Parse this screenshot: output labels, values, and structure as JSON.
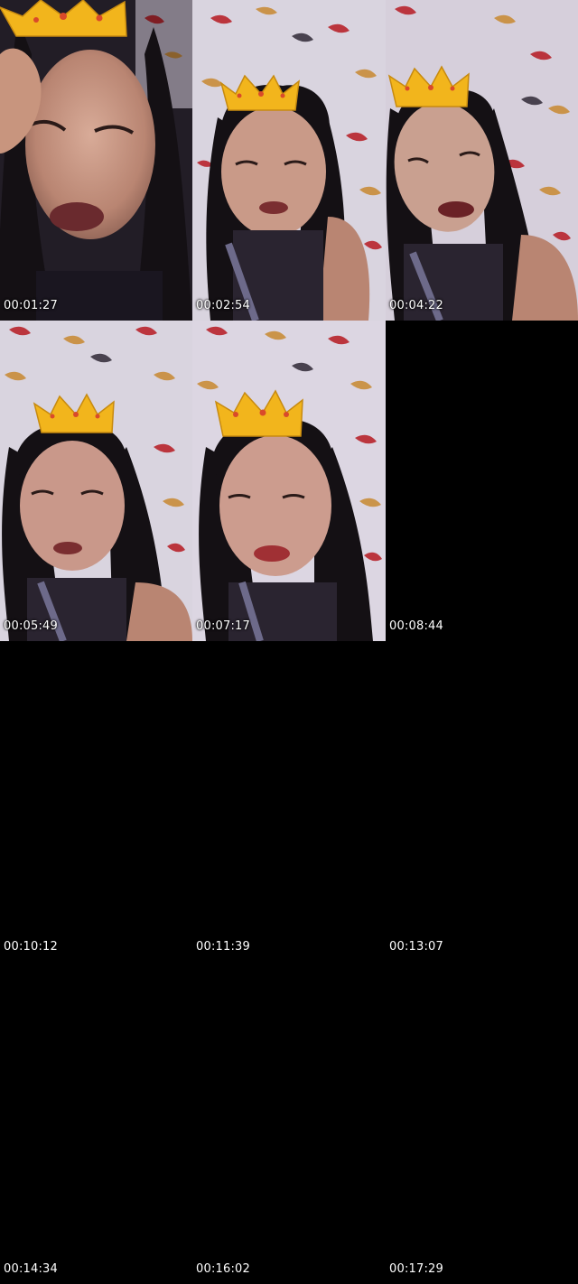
{
  "contact_sheet": {
    "frames": [
      {
        "timestamp": "00:01:27",
        "content": "photo",
        "scene": "portrait-closeup-hand-on-forehead"
      },
      {
        "timestamp": "00:02:54",
        "content": "photo",
        "scene": "portrait-wallpaper"
      },
      {
        "timestamp": "00:04:22",
        "content": "photo",
        "scene": "portrait-wallpaper-tilted"
      },
      {
        "timestamp": "00:05:49",
        "content": "photo",
        "scene": "portrait-wallpaper"
      },
      {
        "timestamp": "00:07:17",
        "content": "photo",
        "scene": "portrait-wallpaper"
      },
      {
        "timestamp": "00:08:44",
        "content": "blank"
      },
      {
        "timestamp": "00:10:12",
        "content": "blank"
      },
      {
        "timestamp": "00:11:39",
        "content": "blank"
      },
      {
        "timestamp": "00:13:07",
        "content": "blank"
      },
      {
        "timestamp": "00:14:34",
        "content": "blank"
      },
      {
        "timestamp": "00:16:02",
        "content": "blank"
      },
      {
        "timestamp": "00:17:29",
        "content": "blank"
      }
    ],
    "colors": {
      "background": "#000000",
      "timestamp_text": "#ffffff",
      "wallpaper": "#d9d4df",
      "koi_red": "#b8242c",
      "koi_gold": "#c98d3a",
      "hair": "#141014",
      "skin": "#c99a88",
      "crown_gold": "#f2b51c"
    }
  }
}
